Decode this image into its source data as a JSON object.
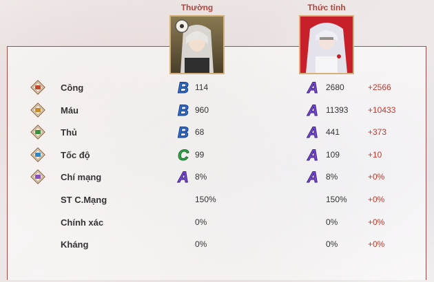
{
  "columns": {
    "normal": "Thường",
    "awakened": "Thức tỉnh"
  },
  "colors": {
    "accent": "#b0443c",
    "border": "#9e4b4b",
    "bonus": "#c0392b"
  },
  "stats": [
    {
      "label": "Công",
      "icon": "attack-icon",
      "grade_normal": "B",
      "normal": "114",
      "grade_awakened": "A",
      "awakened": "2680",
      "bonus": "+2566"
    },
    {
      "label": "Máu",
      "icon": "hp-icon",
      "grade_normal": "B",
      "normal": "960",
      "grade_awakened": "A",
      "awakened": "11393",
      "bonus": "+10433"
    },
    {
      "label": "Thủ",
      "icon": "defense-icon",
      "grade_normal": "B",
      "normal": "68",
      "grade_awakened": "A",
      "awakened": "441",
      "bonus": "+373"
    },
    {
      "label": "Tốc độ",
      "icon": "speed-icon",
      "grade_normal": "C",
      "normal": "99",
      "grade_awakened": "A",
      "awakened": "109",
      "bonus": "+10"
    },
    {
      "label": "Chí mạng",
      "icon": "crit-icon",
      "grade_normal": "A",
      "normal": "8%",
      "grade_awakened": "A",
      "awakened": "8%",
      "bonus": "+0%"
    },
    {
      "label": "ST C.Mạng",
      "normal": "150%",
      "awakened": "150%",
      "bonus": "+0%"
    },
    {
      "label": "Chính xác",
      "normal": "0%",
      "awakened": "0%",
      "bonus": "+0%"
    },
    {
      "label": "Kháng",
      "normal": "0%",
      "awakened": "0%",
      "bonus": "+0%"
    }
  ]
}
